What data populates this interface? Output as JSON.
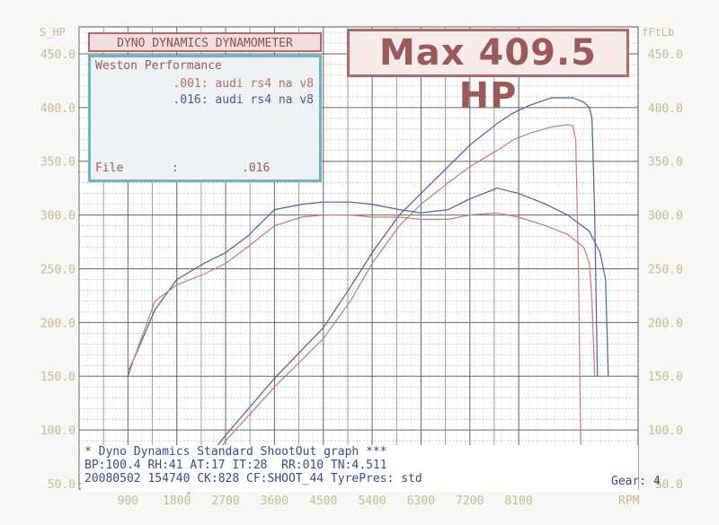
{
  "header": {
    "title": "DYNO DYNAMICS DYNAMOMETER",
    "max": "Max 409.5 HP"
  },
  "info": {
    "company": "Weston Performance",
    "run_red": ".001: audi rs4 na v8",
    "run_blue": ".016: audi rs4 na v8",
    "file_label": "File",
    "file_colon": ":",
    "file_value": ".016"
  },
  "footer": {
    "line1": "* Dyno Dynamics Standard ShootOut graph ***",
    "line2": "BP:100.4 RH:41 AT:17 IT:28  RR:010 TN:4.511",
    "line3": "20080502 154740 CK:828 CF:SHOOT_44 TyrePres: std",
    "gear": "Gear: 4"
  },
  "colors": {
    "red_run": "#c97a7a",
    "blue_run": "#4a5fa8",
    "grid": "#9a9a9a",
    "axis_text": "#c9b98e"
  },
  "chart_data": {
    "type": "line",
    "left_axis_label": "S_HP",
    "right_axis_label": "fFtLb",
    "x_unit": "RPM",
    "left_ticks": [
      "50.0",
      "100.0",
      "150.0",
      "200.0",
      "250.0",
      "300.0",
      "350.0",
      "400.0",
      "450.0"
    ],
    "right_ticks": [
      "50.0",
      "100.0",
      "150.0",
      "200.0",
      "250.0",
      "300.0",
      "350.0",
      "400.0",
      "450.0"
    ],
    "x_ticks": [
      "900",
      "1800",
      "2700",
      "3600",
      "4500",
      "5400",
      "6300",
      "7200",
      "8100"
    ],
    "xlim": [
      0,
      8700
    ],
    "ylim": [
      45,
      475
    ],
    "grid": true,
    "series": [
      {
        "name": ".016: audi rs4 na v8 (HP)",
        "color": "#4a5fa8",
        "points": [
          [
            2000,
            50
          ],
          [
            2700,
            95
          ],
          [
            3600,
            148
          ],
          [
            4500,
            195
          ],
          [
            5000,
            233
          ],
          [
            5400,
            265
          ],
          [
            5900,
            300
          ],
          [
            6300,
            320
          ],
          [
            6800,
            345
          ],
          [
            7200,
            365
          ],
          [
            7700,
            385
          ],
          [
            8000,
            395
          ],
          [
            8300,
            402
          ],
          [
            8700,
            409
          ],
          [
            9100,
            409
          ],
          [
            9300,
            405
          ],
          [
            9400,
            400
          ],
          [
            9450,
            390
          ],
          [
            9500,
            300
          ],
          [
            9550,
            150
          ]
        ]
      },
      {
        "name": ".001: audi rs4 na v8 (HP)",
        "color": "#c97a7a",
        "points": [
          [
            2000,
            40
          ],
          [
            2700,
            90
          ],
          [
            3600,
            140
          ],
          [
            4500,
            185
          ],
          [
            5000,
            220
          ],
          [
            5400,
            255
          ],
          [
            5900,
            290
          ],
          [
            6300,
            310
          ],
          [
            6800,
            330
          ],
          [
            7200,
            345
          ],
          [
            7700,
            360
          ],
          [
            8000,
            370
          ],
          [
            8300,
            376
          ],
          [
            8700,
            382
          ],
          [
            9000,
            384
          ],
          [
            9100,
            383
          ],
          [
            9150,
            370
          ],
          [
            9200,
            250
          ],
          [
            9250,
            60
          ]
        ]
      },
      {
        "name": ".016: audi rs4 na v8 (Torque)",
        "color": "#4a5fa8",
        "points": [
          [
            900,
            150
          ],
          [
            1000,
            165
          ],
          [
            1400,
            212
          ],
          [
            1800,
            240
          ],
          [
            2300,
            255
          ],
          [
            2700,
            265
          ],
          [
            3100,
            280
          ],
          [
            3600,
            305
          ],
          [
            4100,
            310
          ],
          [
            4500,
            312
          ],
          [
            5000,
            312
          ],
          [
            5400,
            310
          ],
          [
            5900,
            305
          ],
          [
            6300,
            302
          ],
          [
            6800,
            305
          ],
          [
            7200,
            315
          ],
          [
            7700,
            325
          ],
          [
            8100,
            320
          ],
          [
            8600,
            310
          ],
          [
            9000,
            300
          ],
          [
            9400,
            285
          ],
          [
            9600,
            265
          ],
          [
            9700,
            240
          ],
          [
            9750,
            150
          ]
        ]
      },
      {
        "name": ".001: audi rs4 na v8 (Torque)",
        "color": "#c97a7a",
        "points": [
          [
            900,
            155
          ],
          [
            1000,
            165
          ],
          [
            1400,
            220
          ],
          [
            1800,
            235
          ],
          [
            2300,
            245
          ],
          [
            2700,
            255
          ],
          [
            3100,
            270
          ],
          [
            3600,
            290
          ],
          [
            4100,
            298
          ],
          [
            4500,
            300
          ],
          [
            5000,
            300
          ],
          [
            5400,
            298
          ],
          [
            5900,
            298
          ],
          [
            6300,
            296
          ],
          [
            6800,
            296
          ],
          [
            7200,
            300
          ],
          [
            7700,
            302
          ],
          [
            8100,
            298
          ],
          [
            8600,
            290
          ],
          [
            9000,
            282
          ],
          [
            9300,
            270
          ],
          [
            9400,
            255
          ],
          [
            9450,
            220
          ],
          [
            9500,
            150
          ]
        ]
      }
    ]
  }
}
